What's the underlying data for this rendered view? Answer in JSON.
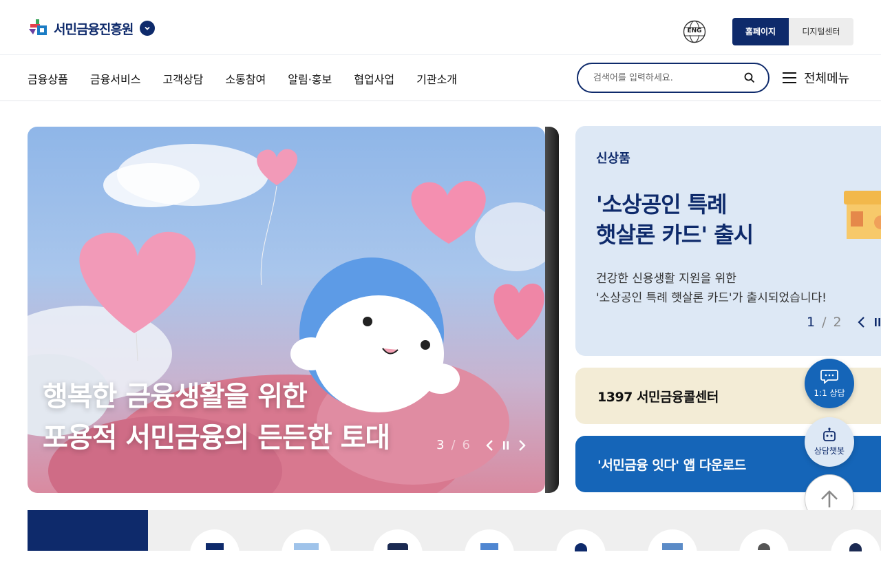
{
  "header": {
    "logo_text": "서민금융진흥원",
    "lang_label": "ENG",
    "seg_home": "홈페이지",
    "seg_digital": "디지털센터"
  },
  "nav": {
    "items": [
      "금융상품",
      "금융서비스",
      "고객상담",
      "소통참여",
      "알림·홍보",
      "협업사업",
      "기관소개"
    ],
    "search_placeholder": "검색어를 입력하세요.",
    "all_menu": "전체메뉴"
  },
  "hero": {
    "line1": "행복한 금융생활을 위한",
    "line2": "포용적 서민금융의 든든한 토대",
    "current": "3",
    "sep": "/",
    "total": "6"
  },
  "new_product": {
    "tag": "신상품",
    "head1": "'소상공인 특례",
    "head2": "햇살론 카드' 출시",
    "desc1": "건강한 신용생활 지원을 위한",
    "desc2": "'소상공인 특례 햇살론 카드'가 출시되었습니다!",
    "current": "1",
    "sep": "/",
    "total": "2"
  },
  "call_center": {
    "label": "1397 서민금융콜센터"
  },
  "app_download": {
    "label": "'서민금융 잇다' 앱 다운로드"
  },
  "floating": {
    "chat_label": "1:1 상담",
    "bot_label": "상담챗봇"
  },
  "colors": {
    "navy": "#0e2a6b",
    "blue": "#1565b8",
    "light_blue": "#dde8f5",
    "cream": "#f3ecd6"
  }
}
